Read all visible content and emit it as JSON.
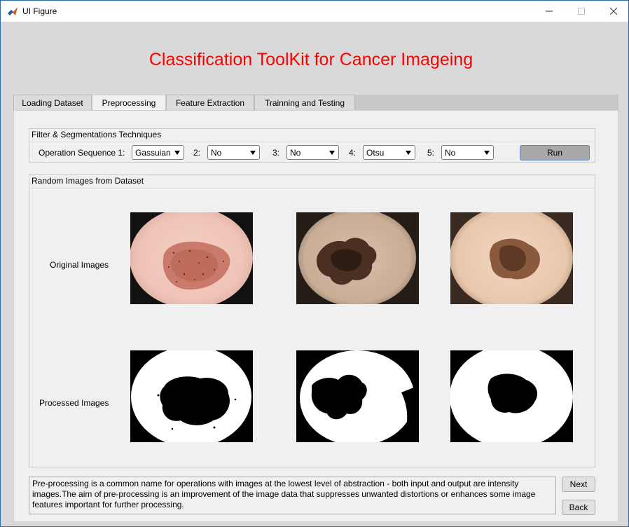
{
  "window": {
    "title": "UI Figure"
  },
  "app_title": "Classification ToolKit for Cancer Imageing",
  "tabs": [
    {
      "label": "Loading Dataset",
      "active": false
    },
    {
      "label": "Preprocessing",
      "active": true
    },
    {
      "label": "Feature Extraction",
      "active": false
    },
    {
      "label": "Trainning and Testing",
      "active": false
    }
  ],
  "filter_panel": {
    "title": "Filter & Segmentations Techniques",
    "seq_label": "Operation Sequence 1:",
    "steps": [
      {
        "label": "",
        "value": "Gassuian"
      },
      {
        "label": "2:",
        "value": "No"
      },
      {
        "label": "3:",
        "value": "No"
      },
      {
        "label": "4:",
        "value": "Otsu"
      },
      {
        "label": "5:",
        "value": "No"
      }
    ],
    "run_label": "Run"
  },
  "images_panel": {
    "title": "Random Images from Dataset",
    "original_label": "Original Images",
    "processed_label": "Processed Images"
  },
  "description": "Pre-processing is a common name for operations with images at the lowest level of abstraction - both input and output are intensity images.The aim of pre-processing is an improvement of the image data that suppresses unwanted distortions or enhances some image features important for further processing.",
  "nav": {
    "next_label": "Next",
    "back_label": "Back"
  },
  "colors": {
    "title_red": "#ff0000",
    "run_border": "#5f86c2"
  }
}
